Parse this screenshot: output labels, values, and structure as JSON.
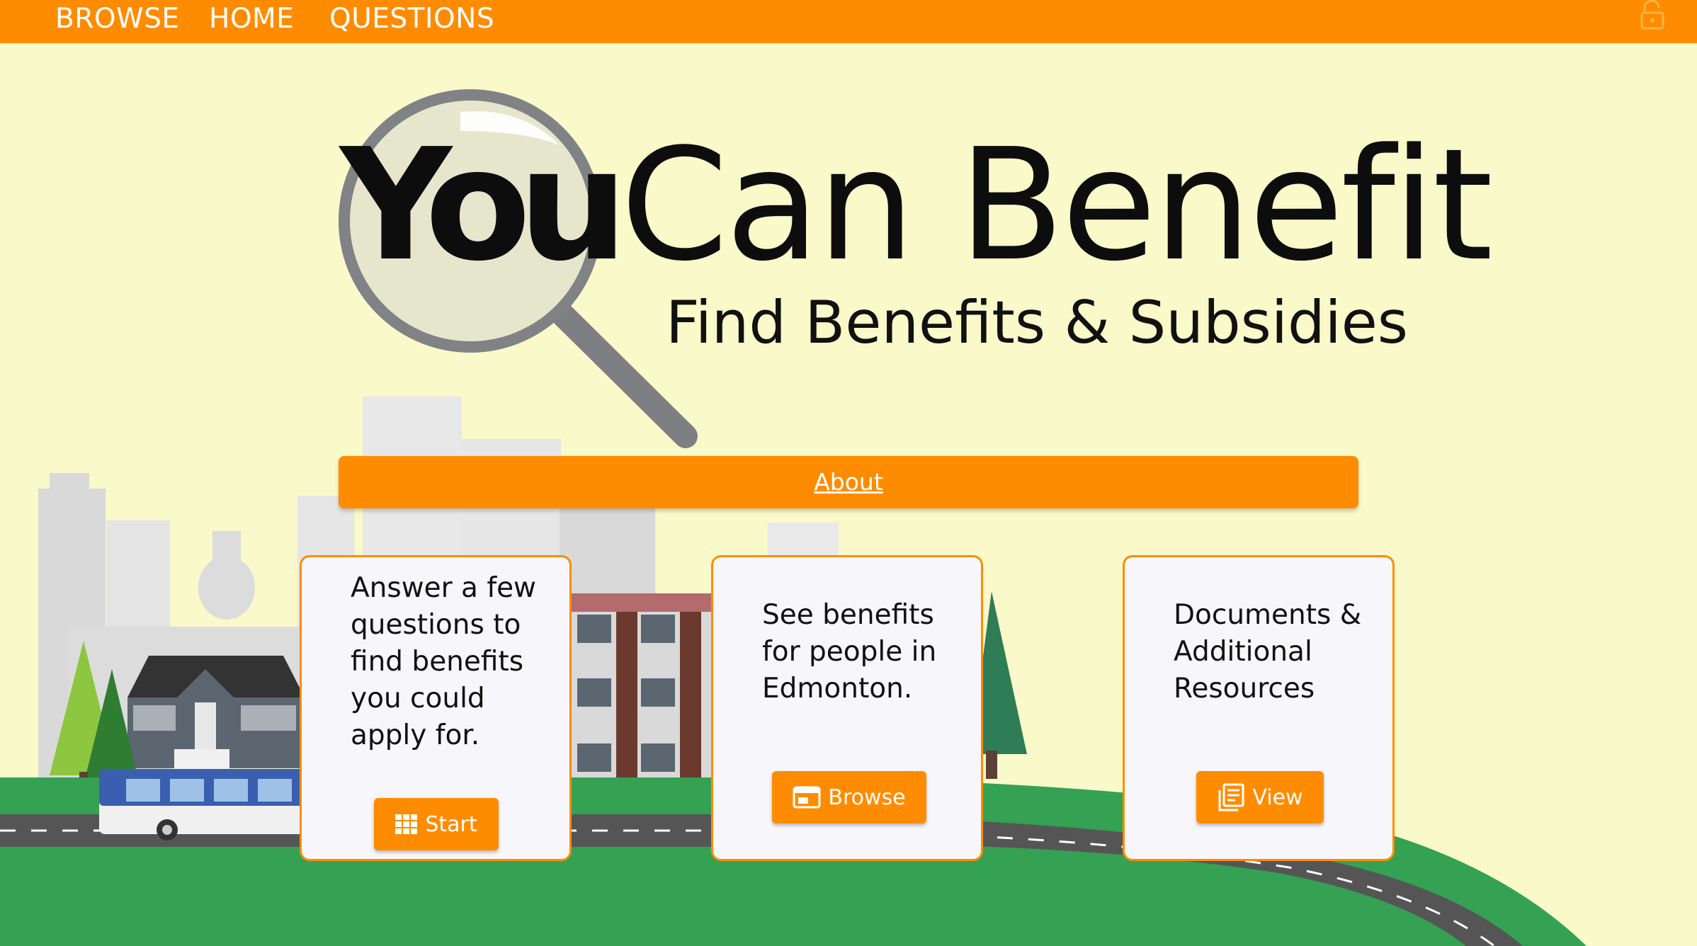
{
  "nav": {
    "items": [
      "BROWSE",
      "HOME",
      "QUESTIONS"
    ],
    "lock_icon": "lock-open-icon"
  },
  "logo": {
    "word_you": "You",
    "word_rest": "Can Benefit",
    "subtitle": "Find Benefits & Subsidies"
  },
  "about": {
    "label": "About"
  },
  "cards": [
    {
      "text": "Answer a few questions to find benefits you could apply for.",
      "button_label": "Start",
      "button_icon": "grid-icon"
    },
    {
      "text": "See benefits for people in Edmonton.",
      "button_label": "Browse",
      "button_icon": "browser-icon"
    },
    {
      "text": "Documents & Additional Resources",
      "button_label": "View",
      "button_icon": "documents-icon"
    }
  ],
  "colors": {
    "accent": "#ff8c00",
    "background": "#f9f9c9",
    "grass": "#34a153",
    "road": "#555555"
  }
}
